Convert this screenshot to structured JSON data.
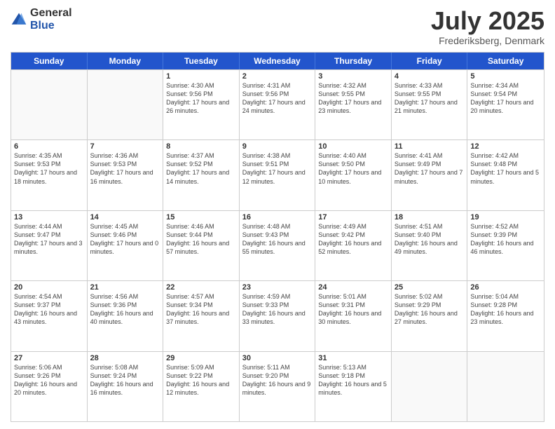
{
  "logo": {
    "general": "General",
    "blue": "Blue"
  },
  "title": "July 2025",
  "subtitle": "Frederiksberg, Denmark",
  "days_of_week": [
    "Sunday",
    "Monday",
    "Tuesday",
    "Wednesday",
    "Thursday",
    "Friday",
    "Saturday"
  ],
  "weeks": [
    [
      {
        "day": "",
        "info": ""
      },
      {
        "day": "",
        "info": ""
      },
      {
        "day": "1",
        "info": "Sunrise: 4:30 AM\nSunset: 9:56 PM\nDaylight: 17 hours and 26 minutes."
      },
      {
        "day": "2",
        "info": "Sunrise: 4:31 AM\nSunset: 9:56 PM\nDaylight: 17 hours and 24 minutes."
      },
      {
        "day": "3",
        "info": "Sunrise: 4:32 AM\nSunset: 9:55 PM\nDaylight: 17 hours and 23 minutes."
      },
      {
        "day": "4",
        "info": "Sunrise: 4:33 AM\nSunset: 9:55 PM\nDaylight: 17 hours and 21 minutes."
      },
      {
        "day": "5",
        "info": "Sunrise: 4:34 AM\nSunset: 9:54 PM\nDaylight: 17 hours and 20 minutes."
      }
    ],
    [
      {
        "day": "6",
        "info": "Sunrise: 4:35 AM\nSunset: 9:53 PM\nDaylight: 17 hours and 18 minutes."
      },
      {
        "day": "7",
        "info": "Sunrise: 4:36 AM\nSunset: 9:53 PM\nDaylight: 17 hours and 16 minutes."
      },
      {
        "day": "8",
        "info": "Sunrise: 4:37 AM\nSunset: 9:52 PM\nDaylight: 17 hours and 14 minutes."
      },
      {
        "day": "9",
        "info": "Sunrise: 4:38 AM\nSunset: 9:51 PM\nDaylight: 17 hours and 12 minutes."
      },
      {
        "day": "10",
        "info": "Sunrise: 4:40 AM\nSunset: 9:50 PM\nDaylight: 17 hours and 10 minutes."
      },
      {
        "day": "11",
        "info": "Sunrise: 4:41 AM\nSunset: 9:49 PM\nDaylight: 17 hours and 7 minutes."
      },
      {
        "day": "12",
        "info": "Sunrise: 4:42 AM\nSunset: 9:48 PM\nDaylight: 17 hours and 5 minutes."
      }
    ],
    [
      {
        "day": "13",
        "info": "Sunrise: 4:44 AM\nSunset: 9:47 PM\nDaylight: 17 hours and 3 minutes."
      },
      {
        "day": "14",
        "info": "Sunrise: 4:45 AM\nSunset: 9:46 PM\nDaylight: 17 hours and 0 minutes."
      },
      {
        "day": "15",
        "info": "Sunrise: 4:46 AM\nSunset: 9:44 PM\nDaylight: 16 hours and 57 minutes."
      },
      {
        "day": "16",
        "info": "Sunrise: 4:48 AM\nSunset: 9:43 PM\nDaylight: 16 hours and 55 minutes."
      },
      {
        "day": "17",
        "info": "Sunrise: 4:49 AM\nSunset: 9:42 PM\nDaylight: 16 hours and 52 minutes."
      },
      {
        "day": "18",
        "info": "Sunrise: 4:51 AM\nSunset: 9:40 PM\nDaylight: 16 hours and 49 minutes."
      },
      {
        "day": "19",
        "info": "Sunrise: 4:52 AM\nSunset: 9:39 PM\nDaylight: 16 hours and 46 minutes."
      }
    ],
    [
      {
        "day": "20",
        "info": "Sunrise: 4:54 AM\nSunset: 9:37 PM\nDaylight: 16 hours and 43 minutes."
      },
      {
        "day": "21",
        "info": "Sunrise: 4:56 AM\nSunset: 9:36 PM\nDaylight: 16 hours and 40 minutes."
      },
      {
        "day": "22",
        "info": "Sunrise: 4:57 AM\nSunset: 9:34 PM\nDaylight: 16 hours and 37 minutes."
      },
      {
        "day": "23",
        "info": "Sunrise: 4:59 AM\nSunset: 9:33 PM\nDaylight: 16 hours and 33 minutes."
      },
      {
        "day": "24",
        "info": "Sunrise: 5:01 AM\nSunset: 9:31 PM\nDaylight: 16 hours and 30 minutes."
      },
      {
        "day": "25",
        "info": "Sunrise: 5:02 AM\nSunset: 9:29 PM\nDaylight: 16 hours and 27 minutes."
      },
      {
        "day": "26",
        "info": "Sunrise: 5:04 AM\nSunset: 9:28 PM\nDaylight: 16 hours and 23 minutes."
      }
    ],
    [
      {
        "day": "27",
        "info": "Sunrise: 5:06 AM\nSunset: 9:26 PM\nDaylight: 16 hours and 20 minutes."
      },
      {
        "day": "28",
        "info": "Sunrise: 5:08 AM\nSunset: 9:24 PM\nDaylight: 16 hours and 16 minutes."
      },
      {
        "day": "29",
        "info": "Sunrise: 5:09 AM\nSunset: 9:22 PM\nDaylight: 16 hours and 12 minutes."
      },
      {
        "day": "30",
        "info": "Sunrise: 5:11 AM\nSunset: 9:20 PM\nDaylight: 16 hours and 9 minutes."
      },
      {
        "day": "31",
        "info": "Sunrise: 5:13 AM\nSunset: 9:18 PM\nDaylight: 16 hours and 5 minutes."
      },
      {
        "day": "",
        "info": ""
      },
      {
        "day": "",
        "info": ""
      }
    ]
  ]
}
